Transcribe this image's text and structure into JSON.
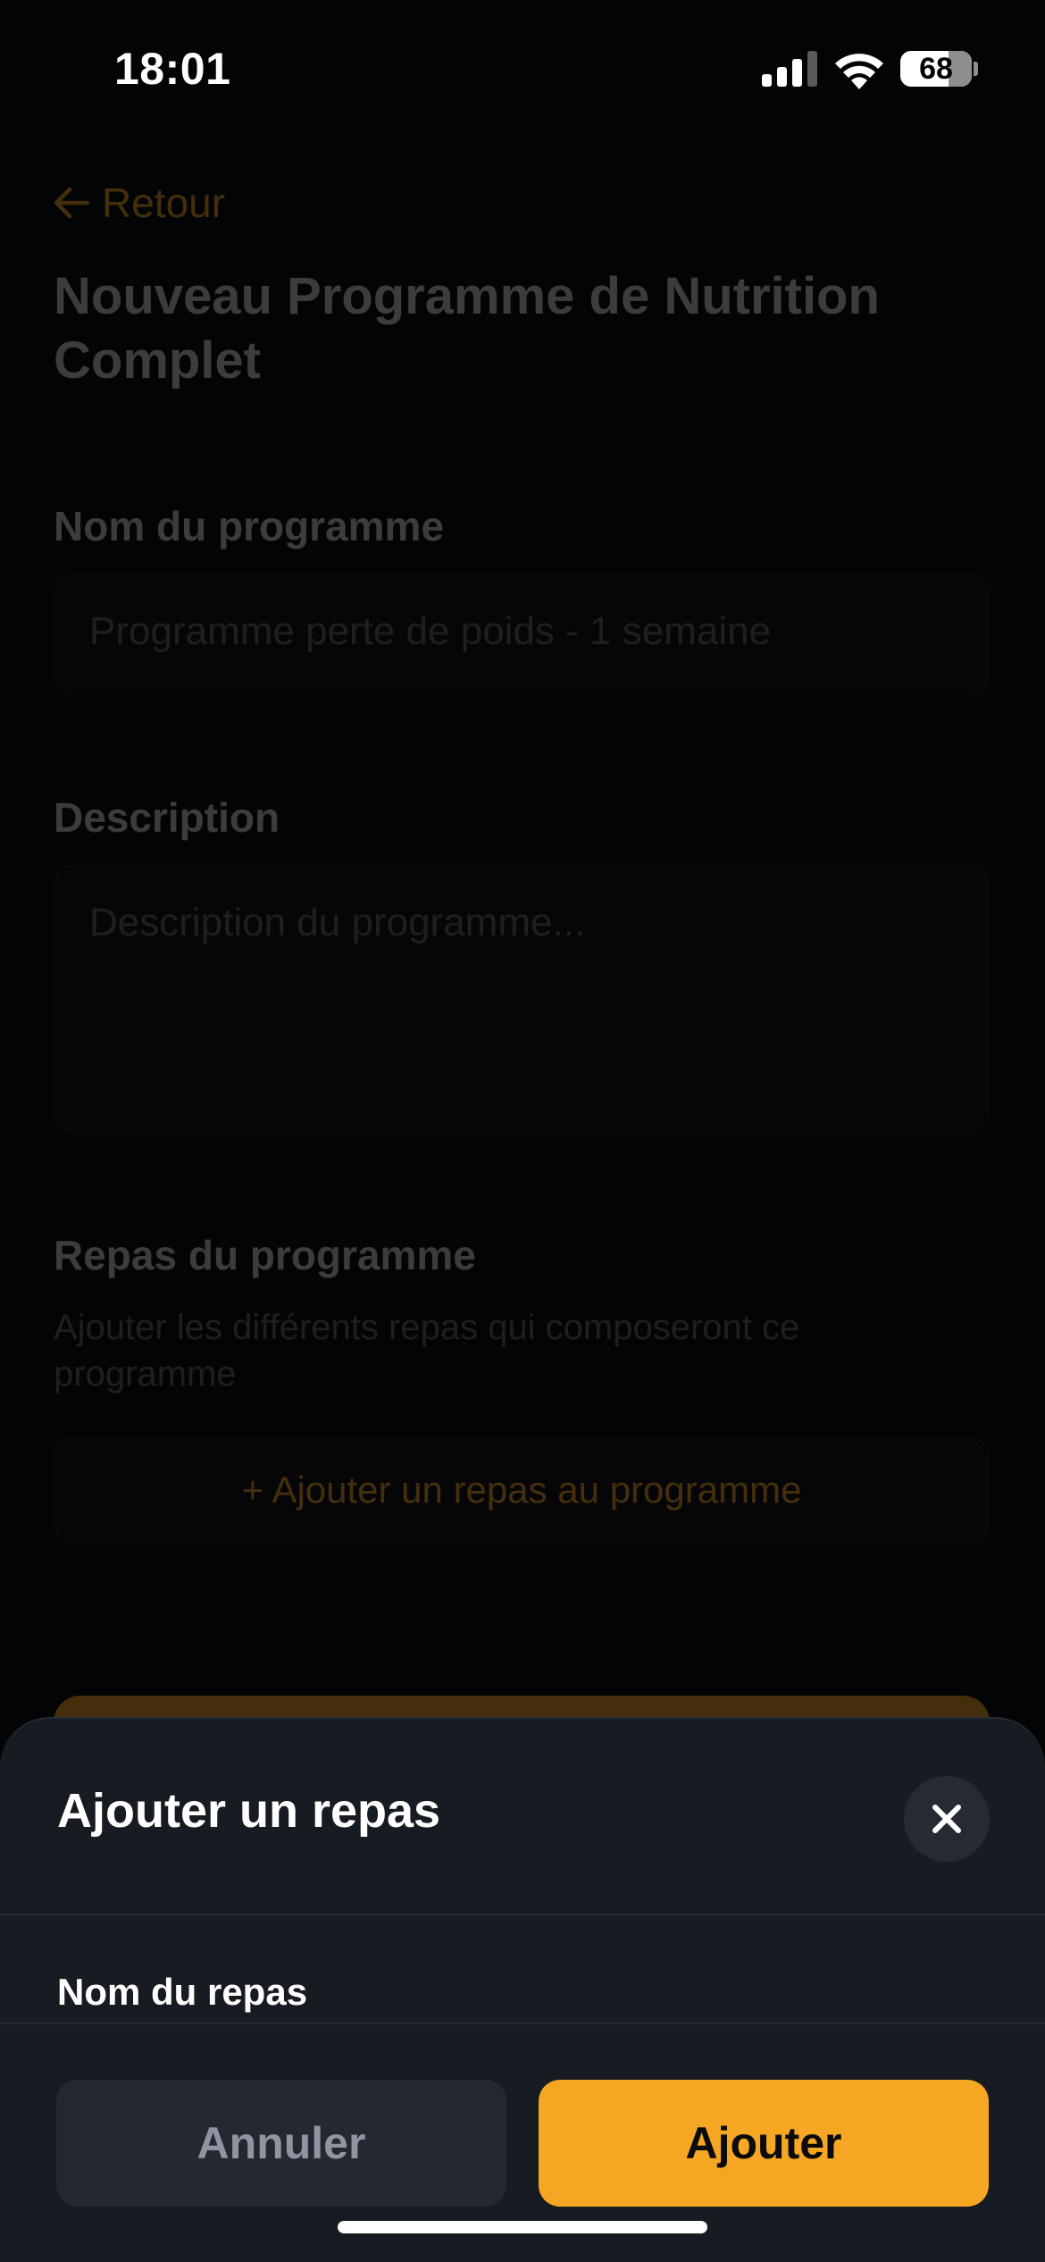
{
  "status_bar": {
    "time": "18:01",
    "battery": "68",
    "battery_level": 0.68,
    "icons": [
      "cellular-signal-icon",
      "wifi-icon",
      "battery-icon"
    ]
  },
  "page": {
    "back_label": "Retour",
    "title": "Nouveau Programme de Nutrition Complet",
    "program_name": {
      "label": "Nom du programme",
      "placeholder": "Programme perte de poids - 1 semaine"
    },
    "description": {
      "label": "Description",
      "placeholder": "Description du programme..."
    },
    "meals": {
      "label": "Repas du programme",
      "subtitle": "Ajouter les différents repas qui composeront ce programme",
      "add_button": "+ Ajouter un repas au programme"
    }
  },
  "sheet": {
    "title": "Ajouter un repas",
    "meal_name_label": "Nom du repas",
    "cancel_label": "Annuler",
    "confirm_label": "Ajouter"
  },
  "colors": {
    "accent": "#f5a623",
    "background": "#030405",
    "sheet_background": "#171b22",
    "cancel_button": "#232831"
  }
}
